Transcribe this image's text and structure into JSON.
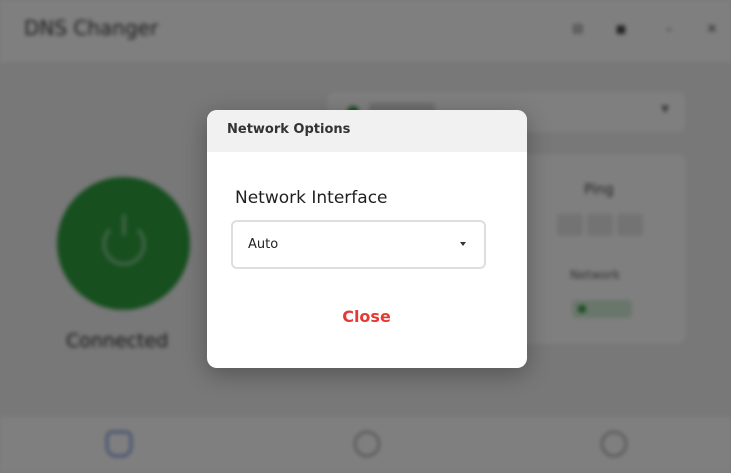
{
  "app": {
    "title": "DNS Changer",
    "status": "Connected",
    "window_controls": [
      "⊟",
      "◼",
      "–",
      "✕"
    ],
    "power_button_color": "#2e9e3e"
  },
  "info": {
    "ping_label": "Ping",
    "network_label": "Network"
  },
  "bottom_nav": {
    "items": [
      "home-icon",
      "info-icon",
      "settings-icon"
    ],
    "active_color": "#5a7fd6"
  },
  "dialog": {
    "title": "Network Options",
    "field_label": "Network Interface",
    "selected_value": "Auto",
    "close_label": "Close",
    "close_color": "#e53935"
  }
}
